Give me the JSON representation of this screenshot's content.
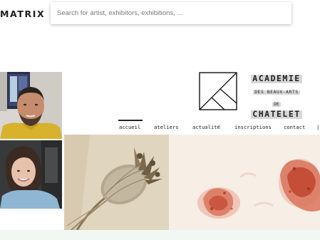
{
  "app": {
    "brand": "MATRIX"
  },
  "search": {
    "placeholder": "Search for artist, exhibitors, exhibitions, ..."
  },
  "site": {
    "logo": {
      "line1": "ACADEMIE",
      "line2": "DES BEAUX-ARTS",
      "line3": "DE",
      "line4": "CHATELET"
    },
    "nav": [
      {
        "label": "accueil",
        "active": true
      },
      {
        "label": "ateliers"
      },
      {
        "label": "actualité"
      },
      {
        "label": "inscriptions"
      },
      {
        "label": "contact"
      }
    ]
  },
  "colors": {
    "accent_text": "#1e1e1e",
    "logo_highlight": "#d8d8d8",
    "footer_tint": "#f1f8f3"
  }
}
